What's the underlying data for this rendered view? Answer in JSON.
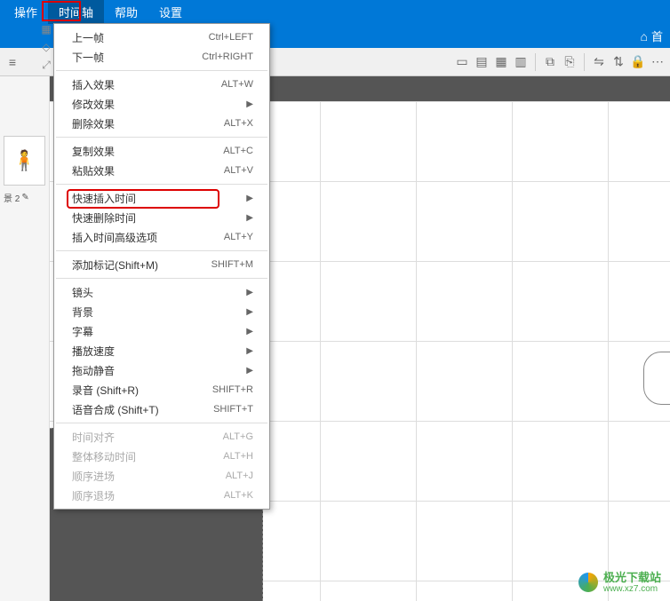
{
  "menubar": {
    "items": [
      "操作",
      "时间轴",
      "帮助",
      "设置"
    ]
  },
  "header": {
    "home_label": "首"
  },
  "left": {
    "label": "景 2"
  },
  "dropdown": {
    "groups": [
      [
        {
          "label": "上一帧",
          "shortcut": "Ctrl+LEFT",
          "type": "cmd"
        },
        {
          "label": "下一帧",
          "shortcut": "Ctrl+RIGHT",
          "type": "cmd"
        }
      ],
      [
        {
          "label": "插入效果",
          "shortcut": "ALT+W",
          "type": "cmd"
        },
        {
          "label": "修改效果",
          "shortcut": "",
          "type": "sub"
        },
        {
          "label": "删除效果",
          "shortcut": "ALT+X",
          "type": "cmd"
        }
      ],
      [
        {
          "label": "复制效果",
          "shortcut": "ALT+C",
          "type": "cmd"
        },
        {
          "label": "粘贴效果",
          "shortcut": "ALT+V",
          "type": "cmd"
        }
      ],
      [
        {
          "label": "快速插入时间",
          "shortcut": "",
          "type": "sub",
          "highlight": true
        },
        {
          "label": "快速删除时间",
          "shortcut": "",
          "type": "sub"
        },
        {
          "label": "插入时间高级选项",
          "shortcut": "ALT+Y",
          "type": "cmd"
        }
      ],
      [
        {
          "label": "添加标记(Shift+M)",
          "shortcut": "SHIFT+M",
          "type": "cmd"
        }
      ],
      [
        {
          "label": "镜头",
          "shortcut": "",
          "type": "sub"
        },
        {
          "label": "背景",
          "shortcut": "",
          "type": "sub"
        },
        {
          "label": "字幕",
          "shortcut": "",
          "type": "sub"
        },
        {
          "label": "播放速度",
          "shortcut": "",
          "type": "sub"
        },
        {
          "label": "拖动静音",
          "shortcut": "",
          "type": "sub"
        },
        {
          "label": "录音 (Shift+R)",
          "shortcut": "SHIFT+R",
          "type": "cmd"
        },
        {
          "label": "语音合成 (Shift+T)",
          "shortcut": "SHIFT+T",
          "type": "cmd"
        }
      ],
      [
        {
          "label": "时间对齐",
          "shortcut": "ALT+G",
          "type": "cmd",
          "disabled": true
        },
        {
          "label": "整体移动时间",
          "shortcut": "ALT+H",
          "type": "cmd",
          "disabled": true
        },
        {
          "label": "顺序进场",
          "shortcut": "ALT+J",
          "type": "cmd",
          "disabled": true
        },
        {
          "label": "顺序退场",
          "shortcut": "ALT+K",
          "type": "cmd",
          "disabled": true
        }
      ]
    ]
  },
  "watermark": {
    "cn": "极光下载站",
    "url": "www.xz7.com"
  }
}
